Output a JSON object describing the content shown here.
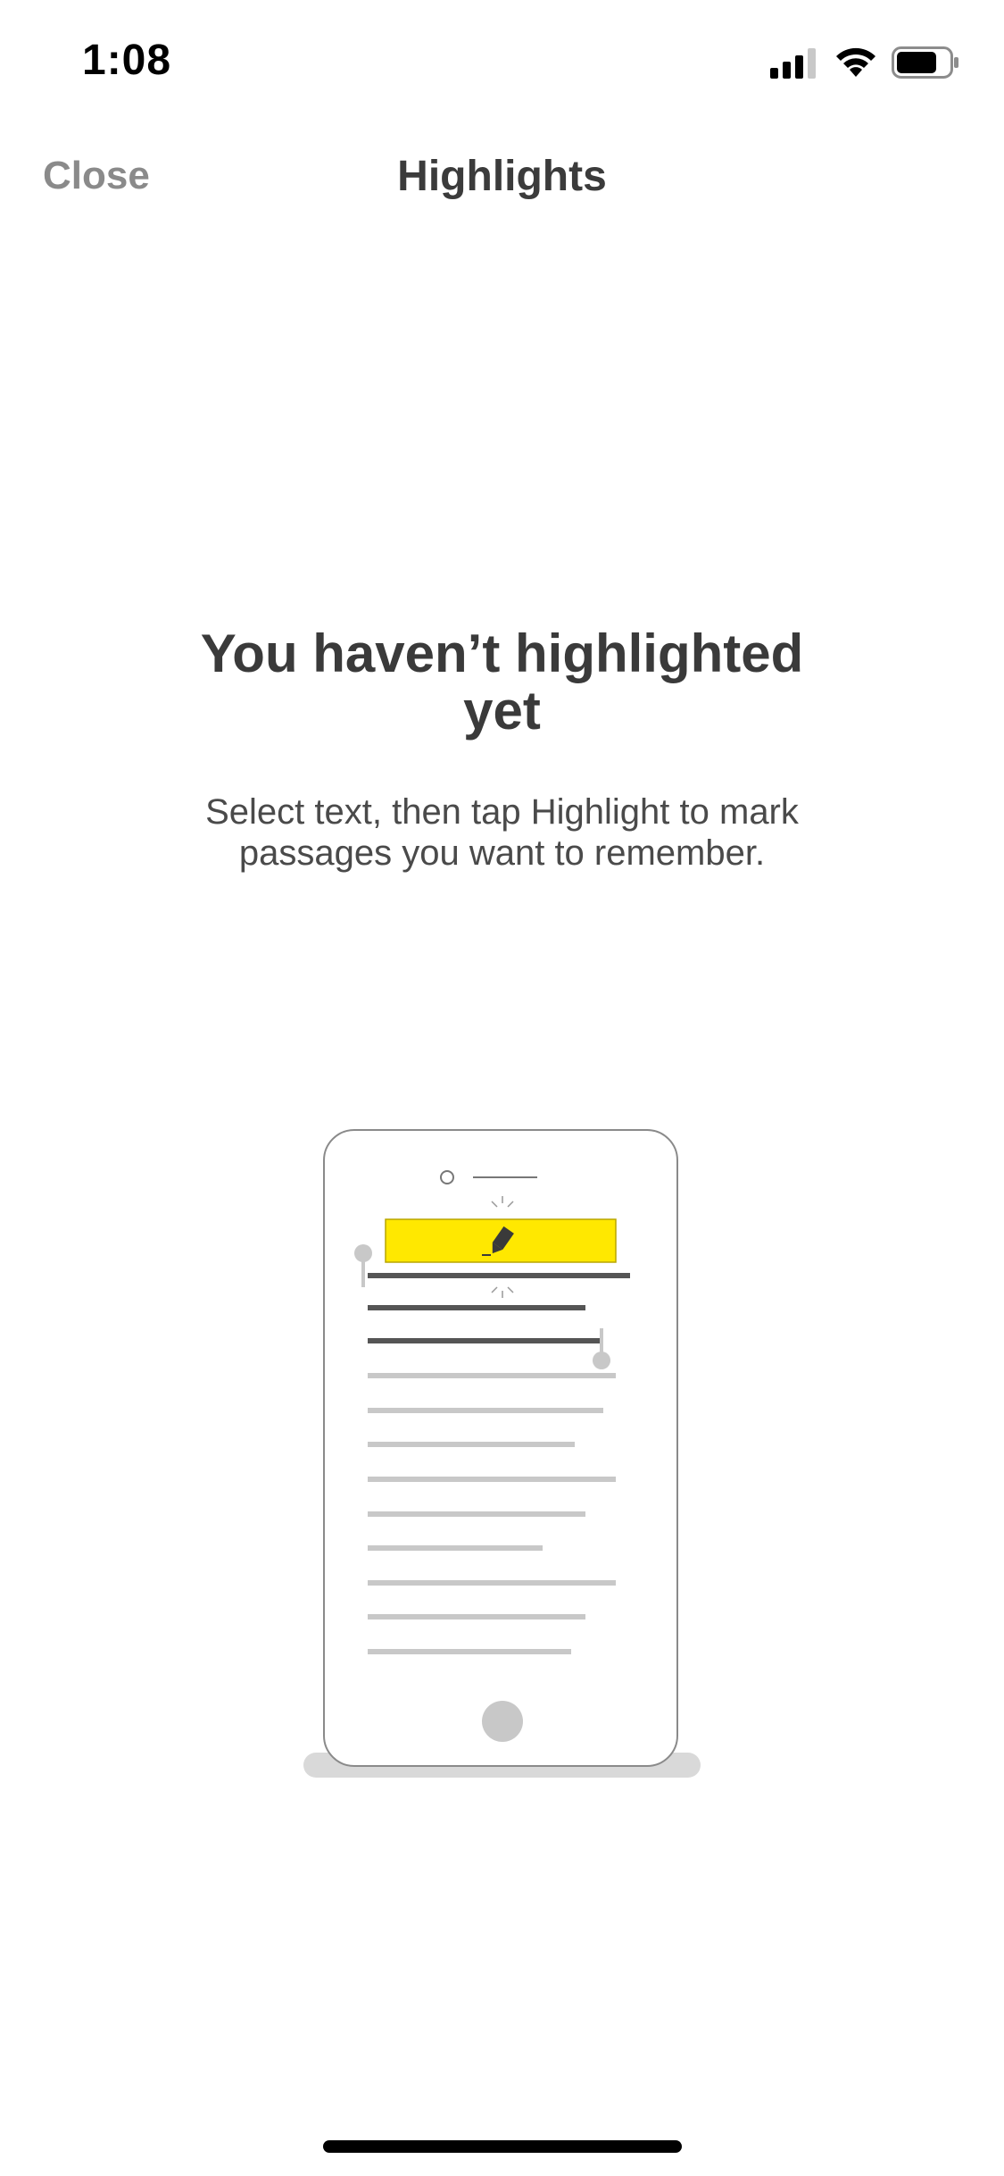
{
  "status_bar": {
    "time": "1:08",
    "icons": [
      "cellular-signal-icon",
      "wifi-icon",
      "battery-icon"
    ]
  },
  "nav": {
    "close_label": "Close",
    "title": "Highlights"
  },
  "empty_state": {
    "heading": "You haven’t highlighted yet",
    "body": "Select text, then tap Highlight to mark passages you want to remember."
  },
  "illustration": {
    "icons": [
      "phone-illustration",
      "highlighter-icon"
    ],
    "highlight_color": "#FFE800"
  },
  "colors": {
    "title_text": "#3b3b3b",
    "close_text": "#8a8a8a",
    "background": "#ffffff"
  }
}
